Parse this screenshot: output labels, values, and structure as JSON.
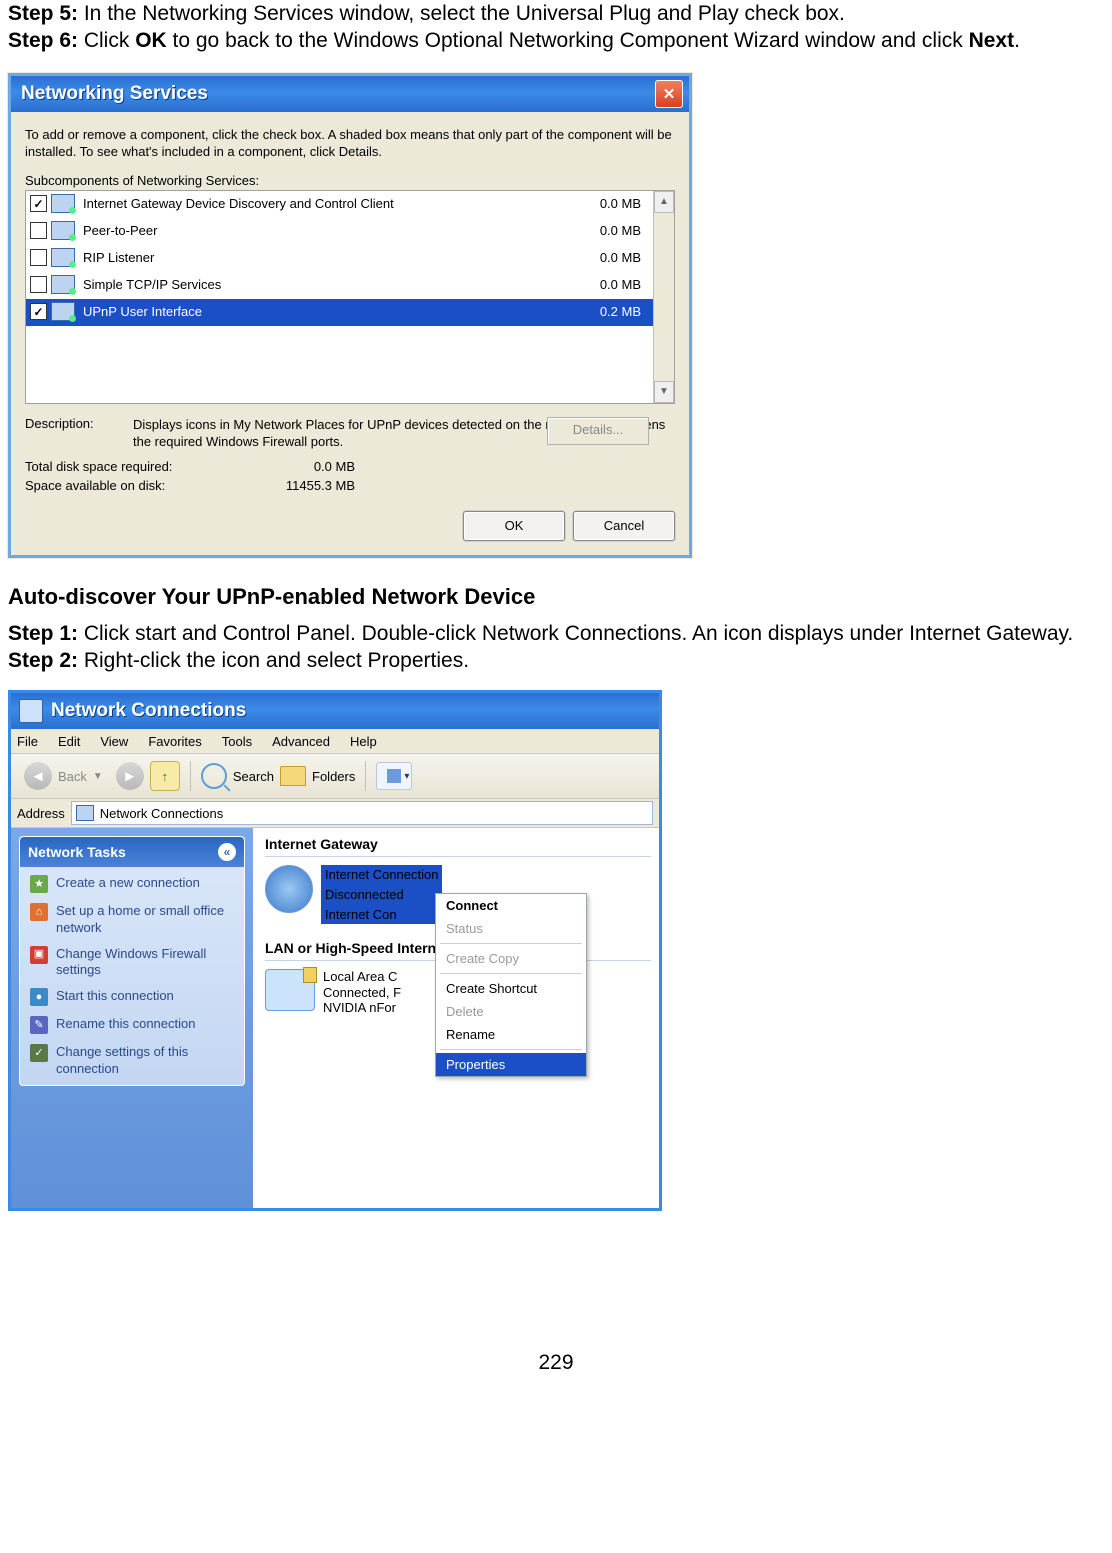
{
  "doc": {
    "step5_label": "Step 5:",
    "step5_text": " In the Networking Services window, select the Universal Plug and Play check box.",
    "step6_label": "Step 6:",
    "step6_pre": " Click ",
    "step6_ok": "OK",
    "step6_mid": " to go back to the Windows Optional Networking Component Wizard window and click ",
    "step6_next": "Next",
    "step6_post": ".",
    "section_heading": "Auto-discover Your UPnP-enabled Network Device",
    "auto_step1_label": "Step 1:",
    "auto_step1_text": " Click start and Control Panel. Double-click Network Connections. An icon displays under Internet Gateway.",
    "auto_step2_label": "Step 2:",
    "auto_step2_text": " Right-click the icon and select Properties.",
    "page_number": "229"
  },
  "ns": {
    "title": "Networking Services",
    "intro": "To add or remove a component, click the check box. A shaded box means that only part of the component will be installed. To see what's included in a component, click Details.",
    "sublabel": "Subcomponents of Networking Services:",
    "rows": [
      {
        "checked": true,
        "name": "Internet Gateway Device Discovery and Control Client",
        "size": "0.0 MB",
        "selected": false
      },
      {
        "checked": false,
        "name": "Peer-to-Peer",
        "size": "0.0 MB",
        "selected": false
      },
      {
        "checked": false,
        "name": "RIP Listener",
        "size": "0.0 MB",
        "selected": false
      },
      {
        "checked": false,
        "name": "Simple TCP/IP Services",
        "size": "0.0 MB",
        "selected": false
      },
      {
        "checked": true,
        "name": "UPnP User Interface",
        "size": "0.2 MB",
        "selected": true
      }
    ],
    "desc_label": "Description:",
    "desc_text": "Displays icons in My Network Places for UPnP devices detected on the network. Also, opens the required Windows Firewall ports.",
    "total_label": "Total disk space required:",
    "total_value": "0.0 MB",
    "avail_label": "Space available on disk:",
    "avail_value": "11455.3 MB",
    "details_btn": "Details...",
    "ok_btn": "OK",
    "cancel_btn": "Cancel"
  },
  "nc": {
    "title": "Network Connections",
    "menu": [
      "File",
      "Edit",
      "View",
      "Favorites",
      "Tools",
      "Advanced",
      "Help"
    ],
    "tb_back": "Back",
    "tb_search": "Search",
    "tb_folders": "Folders",
    "addr_label": "Address",
    "addr_value": "Network Connections",
    "tasks_header": "Network Tasks",
    "tasks": [
      "Create a new connection",
      "Set up a home or small office network",
      "Change Windows Firewall settings",
      "Start this connection",
      "Rename this connection",
      "Change settings of this connection"
    ],
    "group1": "Internet Gateway",
    "ic_line1": "Internet Connection",
    "ic_line2": "Disconnected",
    "ic_line3": "Internet Con",
    "group2": "LAN or High-Speed Internet",
    "lan_line1": "Local Area C",
    "lan_line2": "Connected, F",
    "lan_line3": "NVIDIA nFor",
    "ctx": {
      "connect": "Connect",
      "status": "Status",
      "create_copy": "Create Copy",
      "create_shortcut": "Create Shortcut",
      "delete": "Delete",
      "rename": "Rename",
      "properties": "Properties"
    }
  }
}
